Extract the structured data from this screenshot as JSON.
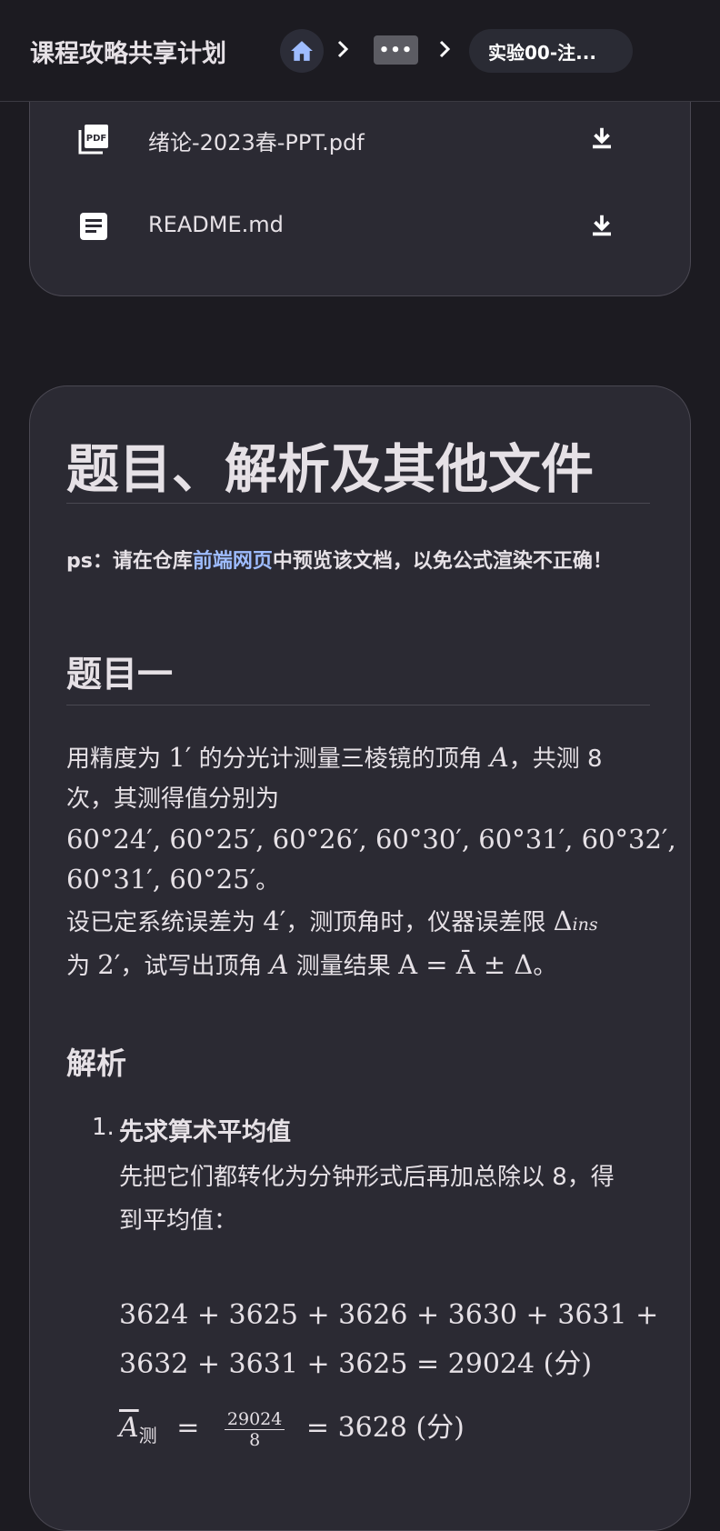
{
  "appbar": {
    "title": "课程攻略共享计划",
    "more_label": "•••",
    "current_crumb": "实验00-注..."
  },
  "files": [
    {
      "name": "绪论-2023春-PPT.pdf",
      "icon": "pdf-icon"
    },
    {
      "name": "README.md",
      "icon": "document-icon"
    }
  ],
  "content": {
    "heading": "题目、解析及其他文件",
    "note_prefix": "ps：请在仓库",
    "note_link": "前端网页",
    "note_suffix": "中预览该文档，以免公式渲染不正确！",
    "problem_heading": "题目一",
    "problem_line1_a": "用精度为 ",
    "problem_line1_m1": "1′",
    "problem_line1_b": " 的分光计测量三棱镜的顶角 ",
    "problem_line1_m2": "A",
    "problem_line1_c": "，共测 8",
    "problem_line2": "次，其测得值分别为",
    "problem_values_1": "60°24′, 60°25′, 60°26′, 60°30′, 60°31′, 60°32′,",
    "problem_values_2": "60°31′, 60°25′",
    "problem_values_end": "。",
    "problem_line4_a": "设已定系统误差为 ",
    "problem_line4_m1": "4′",
    "problem_line4_b": "，测顶角时，仪器误差限 ",
    "problem_line4_m2": "Δ",
    "problem_line4_sub": "ins",
    "problem_line5_a": "为 ",
    "problem_line5_m1": "2′",
    "problem_line5_b": "，试写出顶角 ",
    "problem_line5_m2": "A",
    "problem_line5_c": " 测量结果 ",
    "problem_line5_m3": "A = Ā ± Δ",
    "problem_line5_d": "。",
    "analysis_heading": "解析",
    "step1_num": "1.",
    "step1_title": "先求算术平均值",
    "step1_body": "先把它们都转化为分钟形式后再加总除以 8，得到平均值：",
    "eq1_line1": "3624 + 3625 + 3626 + 3630 + 3631 +",
    "eq1_line2": "3632 + 3631 + 3625  =  29024 (分)",
    "eq2_lhs": "A",
    "eq2_sub": "测",
    "eq2_eq": "=",
    "eq2_num": "29024",
    "eq2_den": "8",
    "eq2_rhs": "=  3628 (分)"
  }
}
